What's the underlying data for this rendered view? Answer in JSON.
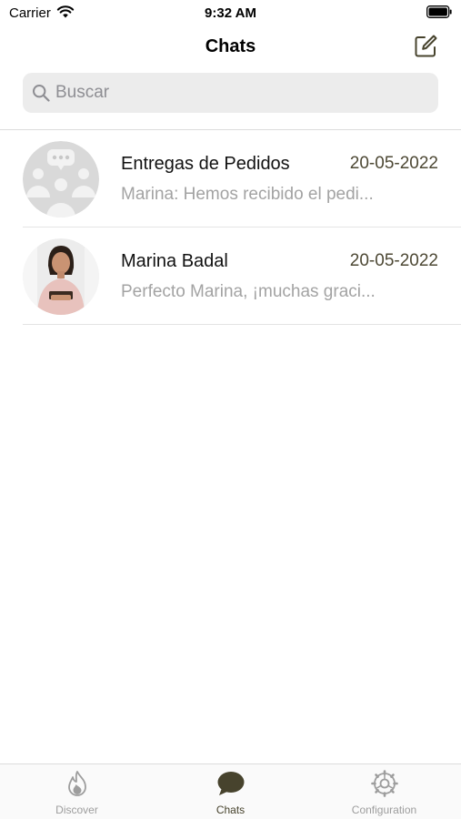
{
  "status_bar": {
    "carrier": "Carrier",
    "time": "9:32 AM",
    "wifi_icon": "wifi-icon",
    "battery_icon": "battery-icon"
  },
  "nav": {
    "title": "Chats",
    "compose_icon": "compose-icon"
  },
  "search": {
    "placeholder": "Buscar",
    "icon": "search-icon"
  },
  "chats": [
    {
      "name": "Entregas de Pedidos",
      "date": "20-05-2022",
      "preview": "Marina: Hemos recibido el pedi...",
      "avatar": "group-avatar"
    },
    {
      "name": "Marina Badal",
      "date": "20-05-2022",
      "preview": "Perfecto Marina, ¡muchas graci...",
      "avatar": "person-avatar"
    }
  ],
  "tabs": [
    {
      "label": "Discover",
      "icon": "flame-icon",
      "active": false
    },
    {
      "label": "Chats",
      "icon": "chat-bubble-icon",
      "active": true
    },
    {
      "label": "Configuration",
      "icon": "settings-gear-icon",
      "active": false
    }
  ],
  "colors": {
    "accent": "#47432d",
    "date_text": "#4d4834",
    "preview_text": "#a3a3a3",
    "inactive_tab": "#9d9d9d",
    "search_bg": "#ececec"
  }
}
